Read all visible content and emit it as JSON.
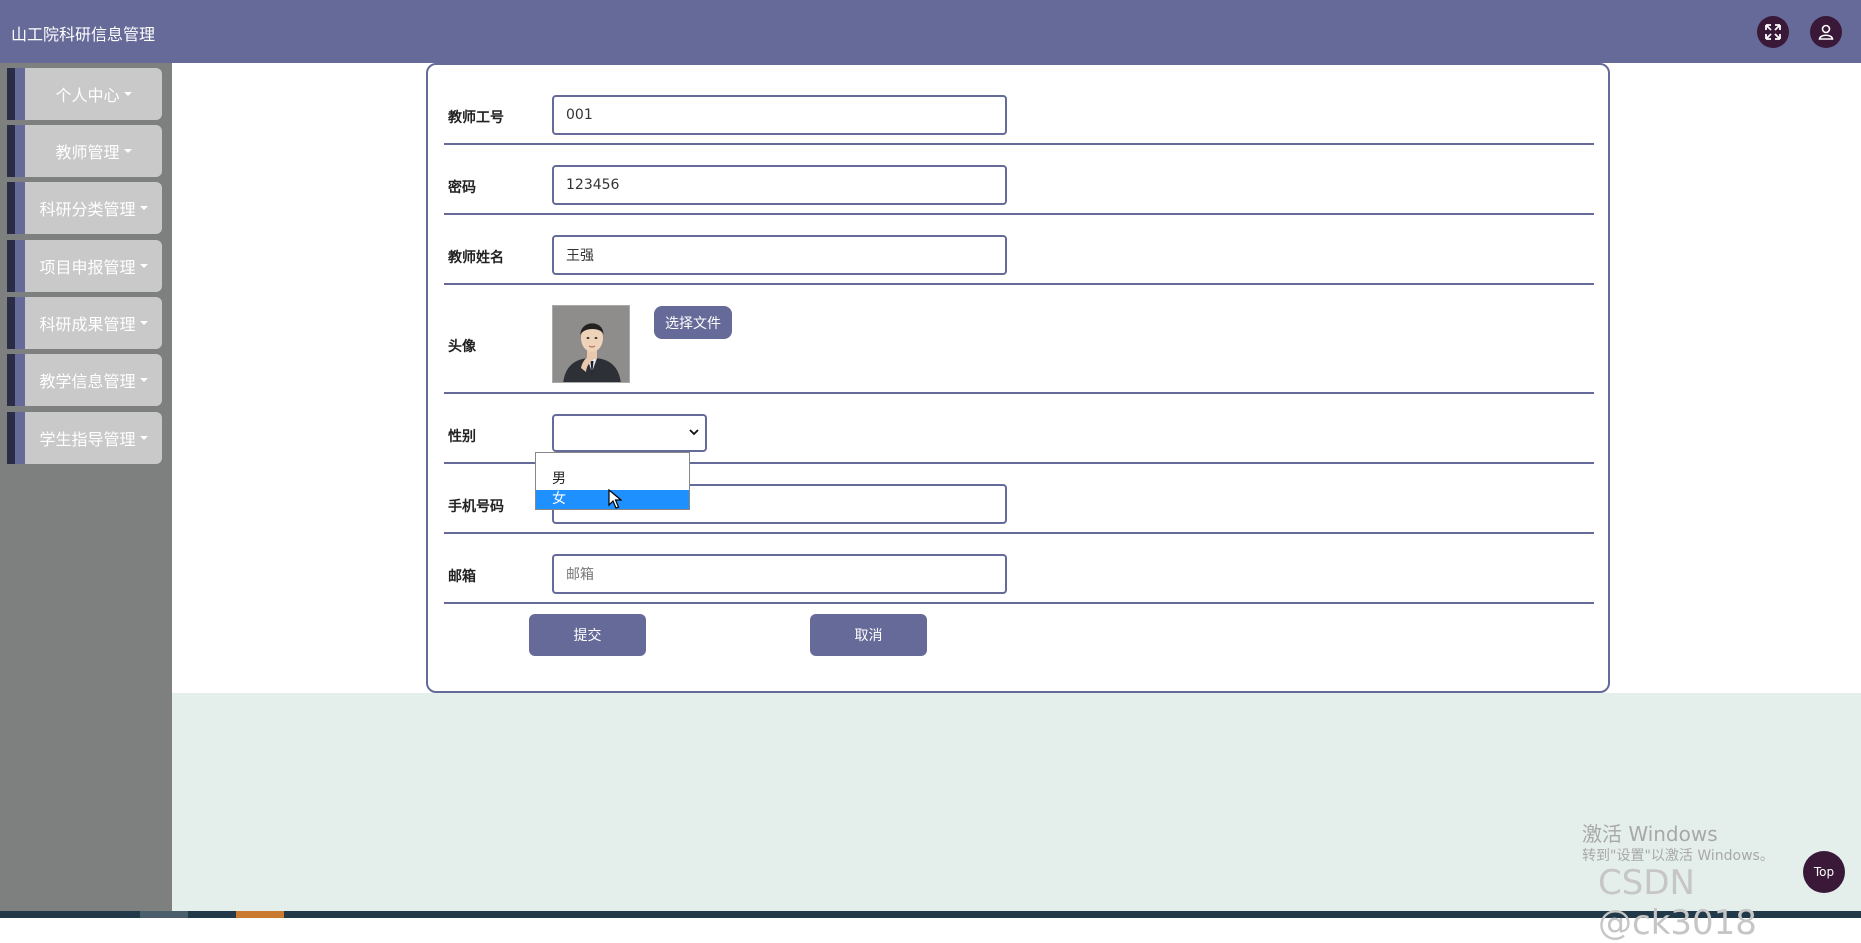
{
  "app": {
    "title": "山工院科研信息管理"
  },
  "header": {
    "icons": [
      "fullscreen-icon",
      "user-icon"
    ]
  },
  "sidebar": {
    "items": [
      {
        "label": "个人中心"
      },
      {
        "label": "教师管理"
      },
      {
        "label": "科研分类管理"
      },
      {
        "label": "项目申报管理"
      },
      {
        "label": "科研成果管理"
      },
      {
        "label": "教学信息管理"
      },
      {
        "label": "学生指导管理"
      }
    ]
  },
  "form": {
    "teacher_id": {
      "label": "教师工号",
      "value": "001"
    },
    "password": {
      "label": "密码",
      "value": "123456"
    },
    "teacher_name": {
      "label": "教师姓名",
      "value": "王强"
    },
    "avatar": {
      "label": "头像",
      "button": "选择文件"
    },
    "gender": {
      "label": "性别",
      "value": "",
      "options": [
        "男",
        "女"
      ],
      "highlighted": "女"
    },
    "phone": {
      "label": "手机号码",
      "value": ""
    },
    "email": {
      "label": "邮箱",
      "placeholder": "邮箱"
    },
    "submit_label": "提交",
    "cancel_label": "取消"
  },
  "overlay": {
    "windows_activate_title": "激活 Windows",
    "windows_activate_sub": "转到\"设置\"以激活 Windows。",
    "top_button": "Top",
    "csdn_watermark": "CSDN @ck3018"
  },
  "colors": {
    "primary": "#666a99",
    "sidebar_bg": "#7d807e",
    "menu_button_bg": "#c8c9c8",
    "bottom_bg": "#e4efeb",
    "selected_option": "#1e90ff"
  }
}
